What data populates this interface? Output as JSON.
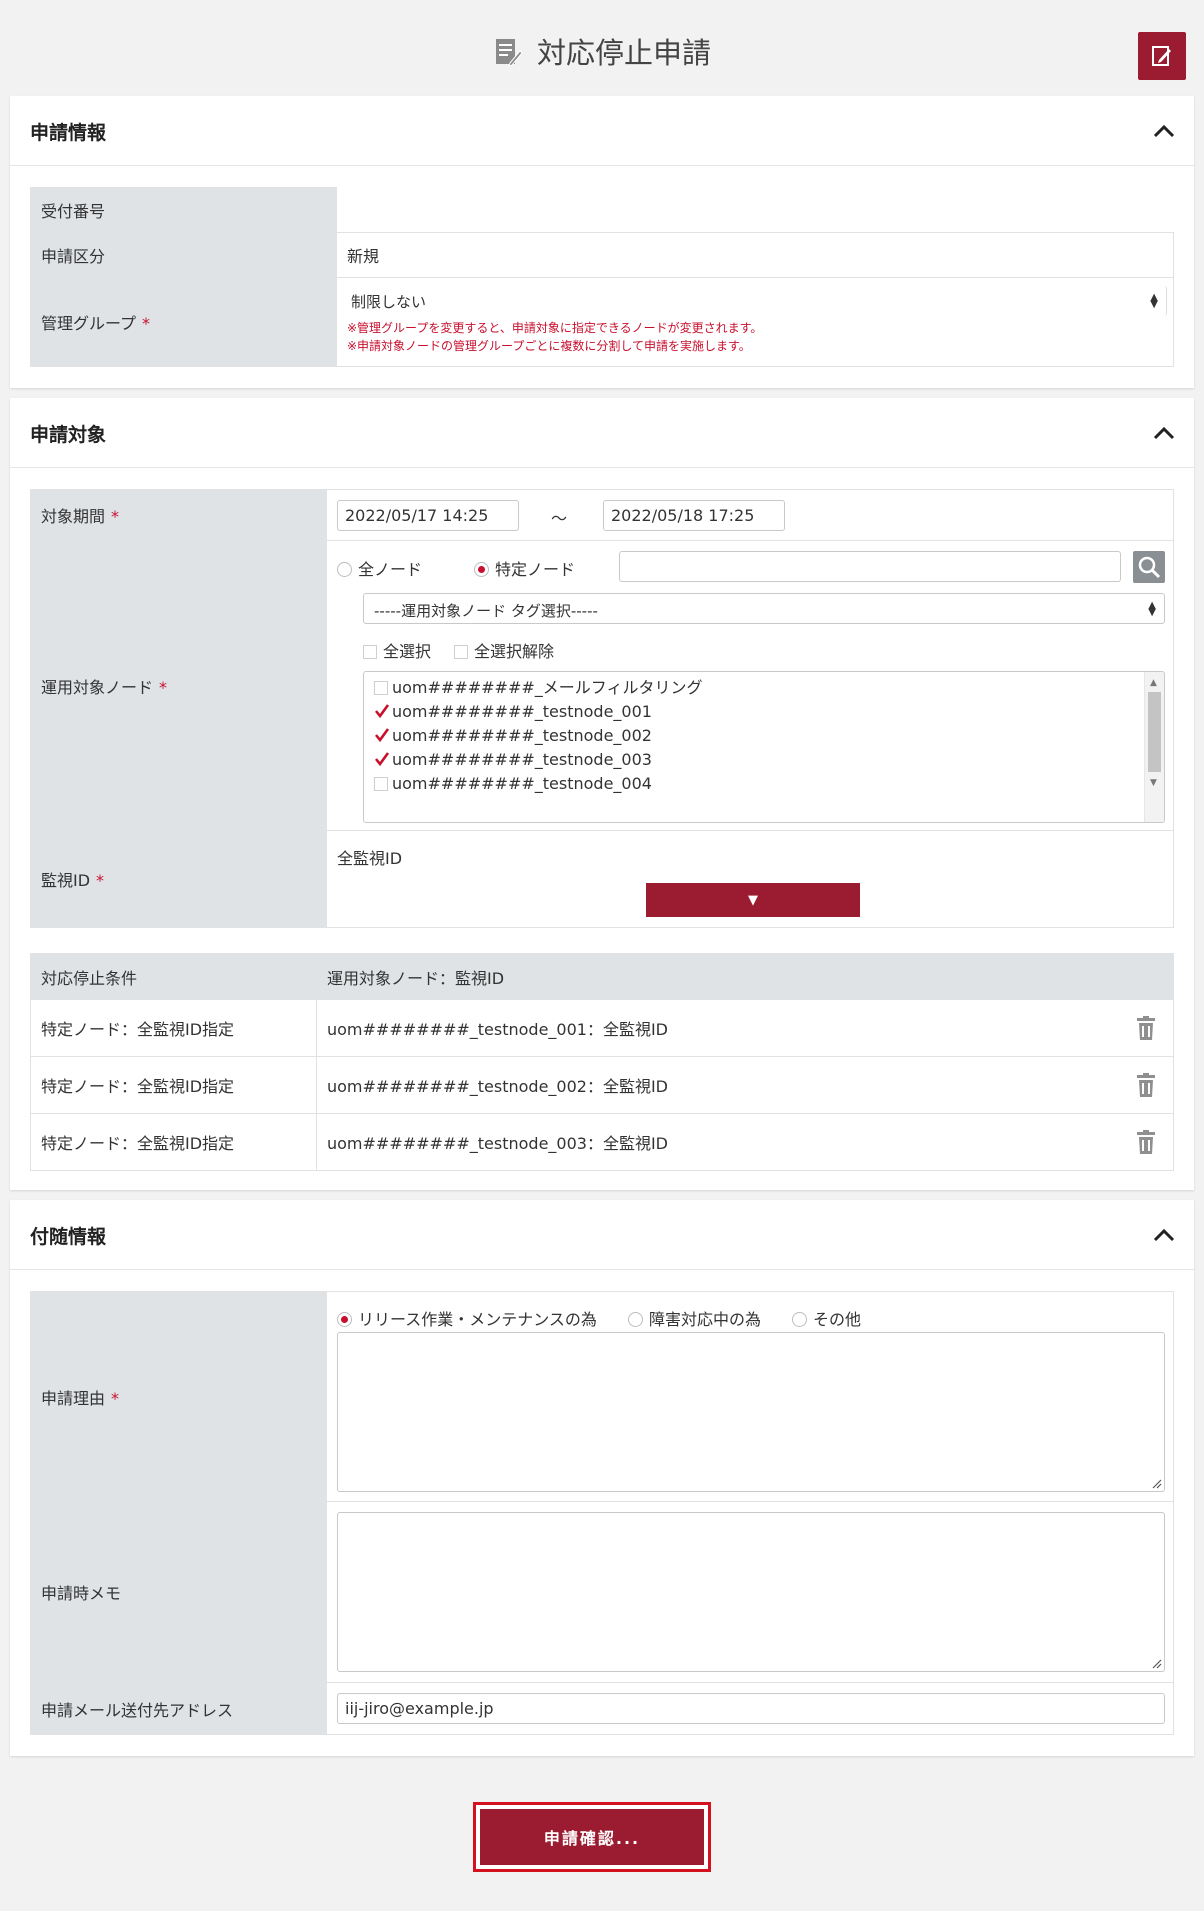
{
  "page": {
    "title": "対応停止申請"
  },
  "section_info": {
    "title": "申請情報",
    "rows": {
      "receipt_no_label": "受付番号",
      "receipt_no_value": "",
      "category_label": "申請区分",
      "category_value": "新規",
      "group_label": "管理グループ",
      "group_value": "制限しない",
      "note1": "※管理グループを変更すると、申請対象に指定できるノードが変更されます。",
      "note2": "※申請対象ノードの管理グループごとに複数に分割して申請を実施します。"
    }
  },
  "section_target": {
    "title": "申請対象",
    "period_label": "対象期間",
    "period_from": "2022/05/17 14:25",
    "period_sep": "〜",
    "period_to": "2022/05/18 17:25",
    "node_label": "運用対象ノード",
    "radio_all": "全ノード",
    "radio_specific": "特定ノード",
    "tag_select": "-----運用対象ノード タグ選択-----",
    "select_all": "全選択",
    "deselect_all": "全選択解除",
    "nodes": [
      {
        "name": "uom########_メールフィルタリング",
        "checked": false
      },
      {
        "name": "uom########_testnode_001",
        "checked": true
      },
      {
        "name": "uom########_testnode_002",
        "checked": true
      },
      {
        "name": "uom########_testnode_003",
        "checked": true
      },
      {
        "name": "uom########_testnode_004",
        "checked": false
      }
    ],
    "monitor_label": "監視ID",
    "monitor_value": "全監視ID",
    "dropdown_glyph": "▼",
    "cond_header_1": "対応停止条件",
    "cond_header_2": "運用対象ノード：監視ID",
    "conditions": [
      {
        "cond": "特定ノード：全監視ID指定",
        "target": "uom########_testnode_001：全監視ID"
      },
      {
        "cond": "特定ノード：全監視ID指定",
        "target": "uom########_testnode_002：全監視ID"
      },
      {
        "cond": "特定ノード：全監視ID指定",
        "target": "uom########_testnode_003：全監視ID"
      }
    ]
  },
  "section_extra": {
    "title": "付随情報",
    "reason_label": "申請理由",
    "reason_opt1": "リリース作業・メンテナンスの為",
    "reason_opt2": "障害対応中の為",
    "reason_opt3": "その他",
    "memo_label": "申請時メモ",
    "mail_label": "申請メール送付先アドレス",
    "mail_value": "iij-jiro@example.jp"
  },
  "actions": {
    "confirm": "申請確認..."
  },
  "required_mark": "*",
  "colors": {
    "brand": "#9b1c30",
    "required": "#c8102e",
    "label_bg": "#dfe3e6"
  }
}
